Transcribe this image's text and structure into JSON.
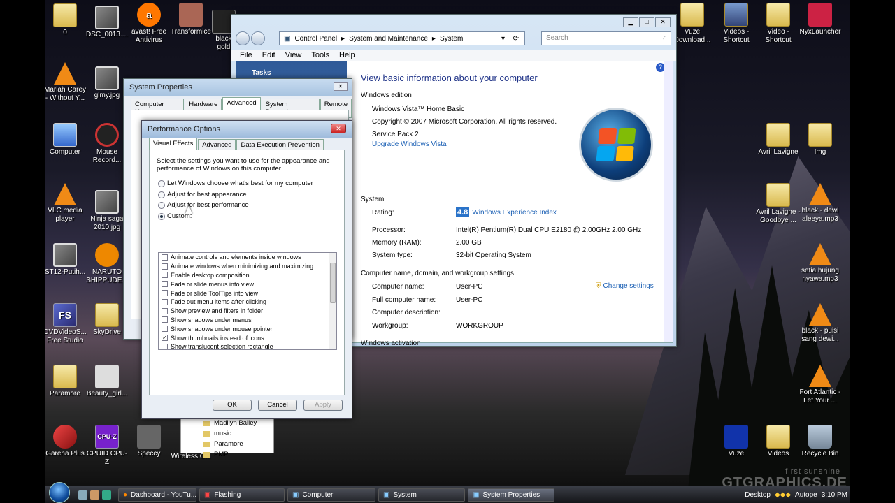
{
  "desktop_icons": [
    {
      "label": "0",
      "x": 0
    },
    {
      "label": "DSC_0013....",
      "x": 0
    },
    {
      "label": "avast! Free Antivirus",
      "x": 0
    },
    {
      "label": "Transformice",
      "x": 0
    },
    {
      "label": "black gold",
      "x": 0
    },
    {
      "label": "Mariah Carey - Without Y...",
      "x": 0
    },
    {
      "label": "glmy.jpg",
      "x": 0
    },
    {
      "label": "Computer",
      "x": 0
    },
    {
      "label": "Mouse Record...",
      "x": 0
    },
    {
      "label": "VLC media player",
      "x": 0
    },
    {
      "label": "Ninja saga 2010.jpg",
      "x": 0
    },
    {
      "label": "ST12-Putih...",
      "x": 0
    },
    {
      "label": "NARUTO SHIPPUDE...",
      "x": 0
    },
    {
      "label": "DVDVideoS... Free Studio",
      "x": 0
    },
    {
      "label": "SkyDrive",
      "x": 0
    },
    {
      "label": "Paramore",
      "x": 0
    },
    {
      "label": "Beauty_girl...",
      "x": 0
    },
    {
      "label": "Garena Plus",
      "x": 0
    },
    {
      "label": "CPUID CPU-Z",
      "x": 0
    },
    {
      "label": "Speccy",
      "x": 0
    },
    {
      "label": "Wireless C...",
      "x": 0
    },
    {
      "label": "Vuze Download...",
      "x": 0
    },
    {
      "label": "Videos - Shortcut",
      "x": 0
    },
    {
      "label": "Video - Shortcut",
      "x": 0
    },
    {
      "label": "NyxLauncher",
      "x": 0
    },
    {
      "label": "Avril Lavigne",
      "x": 0
    },
    {
      "label": "Img",
      "x": 0
    },
    {
      "label": "Avril Lavigne - Goodbye ...",
      "x": 0
    },
    {
      "label": "black - dewi aleeya.mp3",
      "x": 0
    },
    {
      "label": "setia hujung nyawa.mp3",
      "x": 0
    },
    {
      "label": "black - puisi sang dewi...",
      "x": 0
    },
    {
      "label": "Fort Atlantic - Let Your ...",
      "x": 0
    },
    {
      "label": "Vuze",
      "x": 0
    },
    {
      "label": "Videos",
      "x": 0
    },
    {
      "label": "Recycle Bin",
      "x": 0
    }
  ],
  "control_panel": {
    "breadcrumb": [
      "Control Panel",
      "System and Maintenance",
      "System"
    ],
    "search_placeholder": "Search",
    "menu": [
      "File",
      "Edit",
      "View",
      "Tools",
      "Help"
    ],
    "tasks_label": "Tasks",
    "heading": "View basic information about your computer",
    "windows_edition_label": "Windows edition",
    "edition": "Windows Vista™ Home Basic",
    "copyright": "Copyright © 2007 Microsoft Corporation.  All rights reserved.",
    "service_pack": "Service Pack 2",
    "upgrade_link": "Upgrade Windows Vista",
    "system_label": "System",
    "rating_label": "Rating:",
    "rating_score": "4.8",
    "rating_link": "Windows Experience Index",
    "processor_label": "Processor:",
    "processor": "Intel(R) Pentium(R) Dual  CPU  E2180  @ 2.00GHz   2.00 GHz",
    "memory_label": "Memory (RAM):",
    "memory": "2.00 GB",
    "systype_label": "System type:",
    "systype": "32-bit Operating System",
    "netsection_label": "Computer name, domain, and workgroup settings",
    "compname_label": "Computer name:",
    "compname": "User-PC",
    "fullname_label": "Full computer name:",
    "fullname": "User-PC",
    "desc_label": "Computer description:",
    "workgroup_label": "Workgroup:",
    "workgroup": "WORKGROUP",
    "change_settings": "Change settings",
    "activation_label": "Windows activation"
  },
  "system_properties": {
    "title": "System Properties",
    "tabs": [
      "Computer Name",
      "Hardware",
      "Advanced",
      "System Protection",
      "Remote"
    ]
  },
  "performance_options": {
    "title": "Performance Options",
    "tabs": [
      "Visual Effects",
      "Advanced",
      "Data Execution Prevention"
    ],
    "intro": "Select the settings you want to use for the appearance and performance of Windows on this computer.",
    "radios": [
      "Let Windows choose what's best for my computer",
      "Adjust for best appearance",
      "Adjust for best performance",
      "Custom:"
    ],
    "items": [
      {
        "label": "Animate controls and elements inside windows",
        "checked": false
      },
      {
        "label": "Animate windows when minimizing and maximizing",
        "checked": false
      },
      {
        "label": "Enable desktop composition",
        "checked": false
      },
      {
        "label": "Fade or slide menus into view",
        "checked": false
      },
      {
        "label": "Fade or slide ToolTips into view",
        "checked": false
      },
      {
        "label": "Fade out menu items after clicking",
        "checked": false
      },
      {
        "label": "Show preview and filters in folder",
        "checked": false
      },
      {
        "label": "Show shadows under menus",
        "checked": false
      },
      {
        "label": "Show shadows under mouse pointer",
        "checked": false
      },
      {
        "label": "Show thumbnails instead of icons",
        "checked": true
      },
      {
        "label": "Show translucent selection rectangle",
        "checked": false
      }
    ],
    "ok": "OK",
    "cancel": "Cancel",
    "apply": "Apply"
  },
  "explorer": {
    "items": [
      "Madilyn Bailey",
      "music",
      "Paramore",
      "PMP"
    ]
  },
  "taskbar": {
    "buttons": [
      "Dashboard - YouTu...",
      "Flashing",
      "Computer",
      "System",
      "System Properties"
    ],
    "desktop_label": "Desktop",
    "clock": "3:10 PM",
    "tray_text": "Autope"
  },
  "watermark": {
    "line1": "first sunshine",
    "line2": "GTGRAPHICS.DE"
  }
}
